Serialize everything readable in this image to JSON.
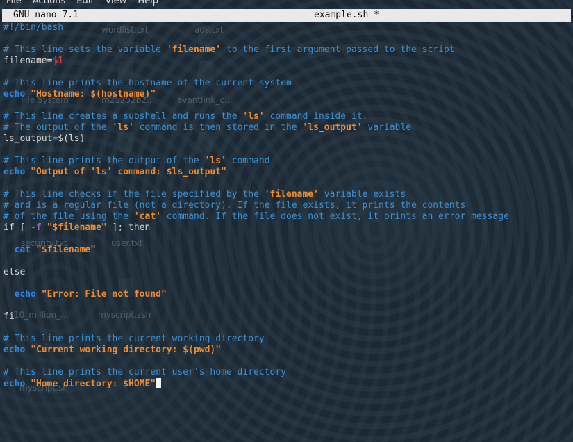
{
  "menubar": {
    "items": [
      "File",
      "Actions",
      "Edit",
      "View",
      "Help"
    ]
  },
  "titlebar": {
    "app": "GNU nano 7.1",
    "file": "example.sh *"
  },
  "desktop_files": [
    "wordlist.txt",
    "ads.txt",
    "File System",
    "m25252b2...",
    "avantlink_c...",
    "security.txt",
    "user.txt",
    "10_million_...",
    "myscript.zsh",
    "myscript.sh"
  ],
  "code": {
    "l1": "#!/bin/bash",
    "l3": "# This line sets the variable ",
    "l3q": "'filename'",
    "l3b": " to the first argument passed to the script",
    "l4a": "filename=",
    "l4v": "$1",
    "l6": "# This line prints the hostname of the current system",
    "l7k": "echo",
    "l7s": " \"Hostname: $(hostname)\"",
    "l9a": "# This line creates a subshell and runs the ",
    "l9q": "'ls'",
    "l9b": " command inside it.",
    "l10a": "# The output of the ",
    "l10q": "'ls'",
    "l10b": " command is then stored in the ",
    "l10q2": "'ls_output'",
    "l10c": " variable",
    "l11a": "ls_output",
    "l11o": "=",
    "l11b": "$(ls)",
    "l13a": "# This line prints the output of the ",
    "l13q": "'ls'",
    "l13b": " command",
    "l14k": "echo",
    "l14s": " \"Output of 'ls' command: $ls_output\"",
    "l16a": "# This line checks if the file specified by the ",
    "l16q": "'filename'",
    "l16b": " variable exists",
    "l17": "# and is a regular file (not a directory). If the file exists, it prints the contents",
    "l18a": "# of the file using the ",
    "l18q": "'cat'",
    "l18b": " command. If the file does not exist, it prints an error message",
    "l19a": "if [ ",
    "l19o": "-f",
    "l19s": " \"$filename\"",
    "l19b": " ]; then",
    "l21k": "  cat",
    "l21s": " \"$filename\"",
    "l23": "else",
    "l25k": "  echo",
    "l25s": " \"Error: File not found\"",
    "l27": "fi",
    "l29": "# This line prints the current working directory",
    "l30k": "echo",
    "l30s": " \"Current working directory: $(pwd)\"",
    "l32": "# This line prints the current user's home directory",
    "l33k": "echo",
    "l33s": " \"Home directory: $HOME\""
  }
}
